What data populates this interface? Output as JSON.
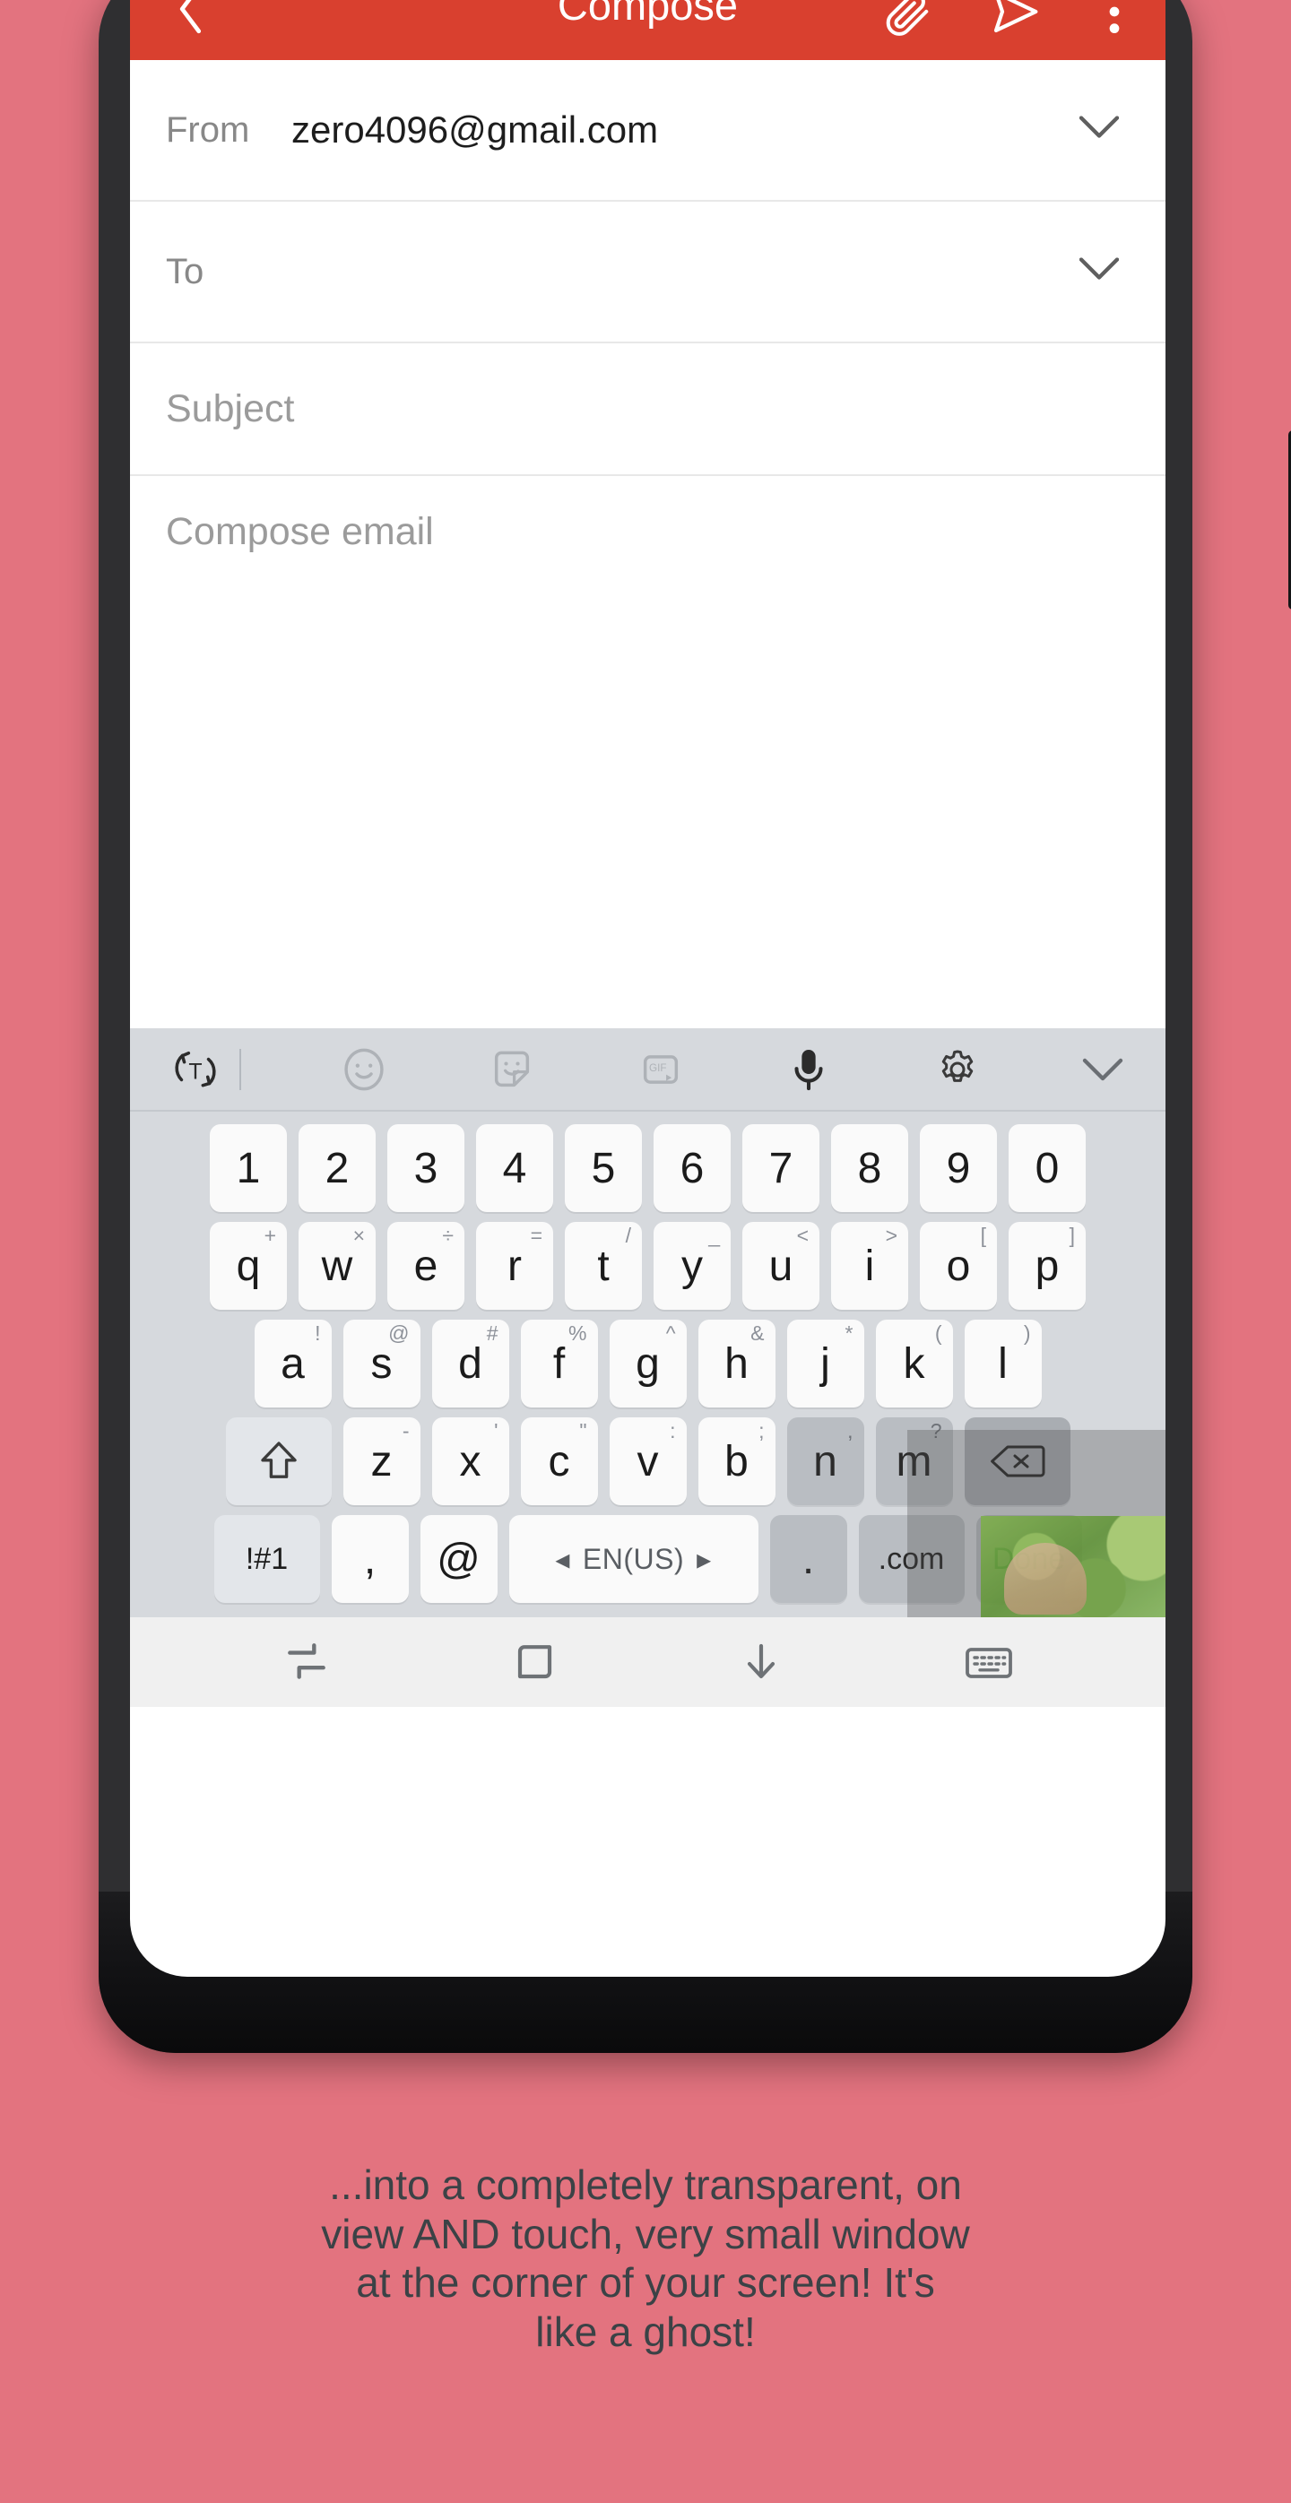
{
  "appbar": {
    "title": "Compose",
    "back_icon": "back-arrow-icon",
    "attach_icon": "attach-icon",
    "send_icon": "send-icon",
    "more_icon": "more-vertical-icon",
    "bg_color": "#d9402f"
  },
  "compose": {
    "from_label": "From",
    "from_value": "zero4096@gmail.com",
    "to_label": "To",
    "to_value": "",
    "subject_placeholder": "Subject",
    "body_placeholder": "Compose email",
    "chevron_icon": "chevron-down-icon"
  },
  "keyboard": {
    "toolbar": [
      {
        "name": "translate-icon",
        "label": "T"
      },
      {
        "name": "divider",
        "label": ""
      },
      {
        "name": "emoji-icon",
        "label": ""
      },
      {
        "name": "sticker-icon",
        "label": ""
      },
      {
        "name": "gif-icon",
        "label": "GIF"
      },
      {
        "name": "microphone-icon",
        "label": ""
      },
      {
        "name": "settings-gear-icon",
        "label": ""
      },
      {
        "name": "collapse-chevron-icon",
        "label": ""
      }
    ],
    "row_numbers": [
      {
        "main": "1",
        "sup": ""
      },
      {
        "main": "2",
        "sup": ""
      },
      {
        "main": "3",
        "sup": ""
      },
      {
        "main": "4",
        "sup": ""
      },
      {
        "main": "5",
        "sup": ""
      },
      {
        "main": "6",
        "sup": ""
      },
      {
        "main": "7",
        "sup": ""
      },
      {
        "main": "8",
        "sup": ""
      },
      {
        "main": "9",
        "sup": ""
      },
      {
        "main": "0",
        "sup": ""
      }
    ],
    "row_top": [
      {
        "main": "q",
        "sup": "+"
      },
      {
        "main": "w",
        "sup": "×"
      },
      {
        "main": "e",
        "sup": "÷"
      },
      {
        "main": "r",
        "sup": "="
      },
      {
        "main": "t",
        "sup": "/"
      },
      {
        "main": "y",
        "sup": "_"
      },
      {
        "main": "u",
        "sup": "<"
      },
      {
        "main": "i",
        "sup": ">"
      },
      {
        "main": "o",
        "sup": "["
      },
      {
        "main": "p",
        "sup": "]"
      }
    ],
    "row_home": [
      {
        "main": "a",
        "sup": "!"
      },
      {
        "main": "s",
        "sup": "@"
      },
      {
        "main": "d",
        "sup": "#"
      },
      {
        "main": "f",
        "sup": "%"
      },
      {
        "main": "g",
        "sup": "^"
      },
      {
        "main": "h",
        "sup": "&"
      },
      {
        "main": "j",
        "sup": "*"
      },
      {
        "main": "k",
        "sup": "("
      },
      {
        "main": "l",
        "sup": ")"
      }
    ],
    "row_bottom_letters": [
      {
        "main": "z",
        "sup": "-"
      },
      {
        "main": "x",
        "sup": "'"
      },
      {
        "main": "c",
        "sup": "\""
      },
      {
        "main": "v",
        "sup": ":"
      },
      {
        "main": "b",
        "sup": ";"
      },
      {
        "main": "n",
        "sup": ","
      },
      {
        "main": "m",
        "sup": "?"
      }
    ],
    "shift_key": "shift-icon",
    "backspace_key": "backspace-icon",
    "symbols_key": "!#1",
    "comma_key": ",",
    "at_key": "@",
    "language_key": "EN(US)",
    "language_prev": "◂",
    "language_next": "▸",
    "period_key": ".",
    "dotcom_key": ".com",
    "done_key": "Done",
    "done_color": "#1f7a4d"
  },
  "navbar": {
    "recents_icon": "split-screen-icon",
    "home_icon": "home-square-icon",
    "hide_keyboard_icon": "arrow-down-icon",
    "keyboard_icon": "keyboard-icon"
  },
  "caption": {
    "line1": "...into a completely transparent, on",
    "line2": "view AND touch, very small window",
    "line3": "at the corner of your screen! It's",
    "line4": "like a ghost!",
    "color": "#3b4246"
  },
  "background": {
    "color": "#e3737f"
  }
}
